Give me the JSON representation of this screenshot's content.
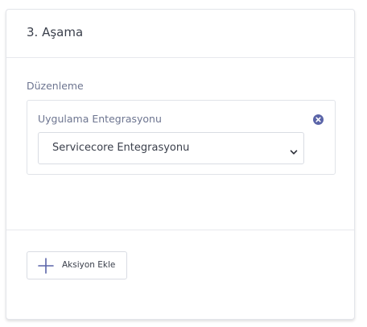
{
  "card": {
    "title": "3. Aşama"
  },
  "section": {
    "label": "Düzenleme"
  },
  "action": {
    "label": "Uygulama Entegrasyonu",
    "selected_value": "Servicecore Entegrasyonu",
    "remove_icon": "close-circle-icon"
  },
  "footer": {
    "add_action_label": "Aksiyon Ekle",
    "add_icon": "plus-icon"
  },
  "colors": {
    "accent": "#5a64a8",
    "text": "#3a3f4b",
    "muted": "#6d7590",
    "border": "#e0e3e8"
  }
}
